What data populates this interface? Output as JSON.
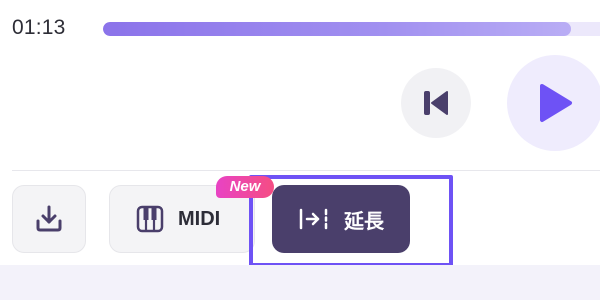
{
  "player": {
    "time": "01:13",
    "progress": 0.9
  },
  "toolbar": {
    "midi_label": "MIDI",
    "new_badge": "New",
    "extend_label": "延長"
  },
  "colors": {
    "accent": "#6e52f5",
    "play_icon": "#6e52f5",
    "extend_button_bg": "#4a3f6b",
    "badge_start": "#e843c4",
    "badge_end": "#f54d83"
  },
  "icons": {
    "prev": "skip-back-icon",
    "play": "play-icon",
    "download": "download-icon",
    "midi": "piano-keys-icon",
    "extend": "extend-arrow-icon"
  }
}
